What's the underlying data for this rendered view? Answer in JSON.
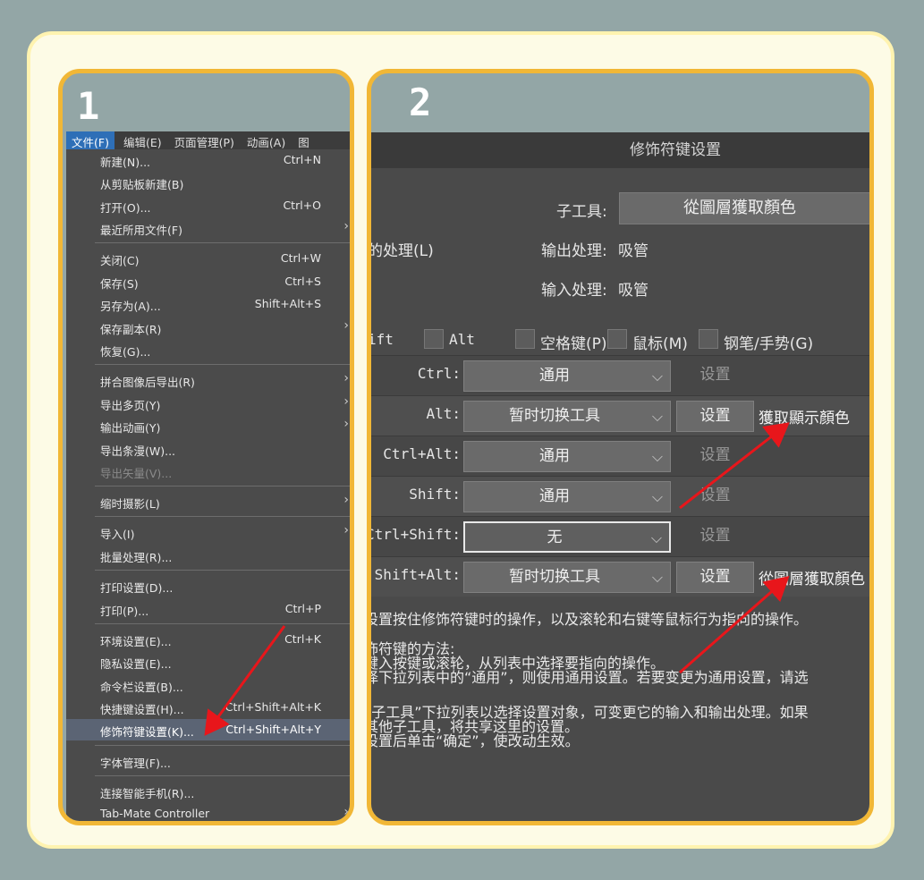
{
  "steps": {
    "one": "1",
    "two": "2"
  },
  "menubar": [
    "文件(F)",
    "编辑(E)",
    "页面管理(P)",
    "动画(A)",
    "图"
  ],
  "menu": {
    "new": {
      "label": "新建(N)...",
      "shortcut": "Ctrl+N"
    },
    "new_clip": {
      "label": "从剪贴板新建(B)"
    },
    "open": {
      "label": "打开(O)...",
      "shortcut": "Ctrl+O"
    },
    "recent": {
      "label": "最近所用文件(F)"
    },
    "close": {
      "label": "关闭(C)",
      "shortcut": "Ctrl+W"
    },
    "save": {
      "label": "保存(S)",
      "shortcut": "Ctrl+S"
    },
    "save_as": {
      "label": "另存为(A)...",
      "shortcut": "Shift+Alt+S"
    },
    "save_copy": {
      "label": "保存副本(R)"
    },
    "revert": {
      "label": "恢复(G)..."
    },
    "flatten_export": {
      "label": "拼合图像后导出(R)"
    },
    "export_multi": {
      "label": "导出多页(Y)"
    },
    "export_anim": {
      "label": "输出动画(Y)"
    },
    "export_strip": {
      "label": "导出条漫(W)..."
    },
    "export_vector": {
      "label": "导出矢量(V)..."
    },
    "timelapse": {
      "label": "缩时摄影(L)"
    },
    "import": {
      "label": "导入(I)"
    },
    "batch": {
      "label": "批量处理(R)..."
    },
    "print_setup": {
      "label": "打印设置(D)..."
    },
    "print": {
      "label": "打印(P)...",
      "shortcut": "Ctrl+P"
    },
    "prefs": {
      "label": "环境设置(E)...",
      "shortcut": "Ctrl+K"
    },
    "privacy": {
      "label": "隐私设置(E)..."
    },
    "command_bar": {
      "label": "命令栏设置(B)..."
    },
    "shortcuts": {
      "label": "快捷键设置(H)...",
      "shortcut": "Ctrl+Shift+Alt+K"
    },
    "modifier": {
      "label": "修饰符键设置(K)...",
      "shortcut": "Ctrl+Shift+Alt+Y"
    },
    "fonts": {
      "label": "字体管理(F)..."
    },
    "smartphone": {
      "label": "连接智能手机(R)..."
    },
    "tabmate": {
      "label": "Tab-Mate Controller"
    }
  },
  "dialog": {
    "title": "修饰符键设置",
    "subtool_label": "子工具:",
    "subtool_value": "從圖層獲取顏色",
    "left_fragment": "的处理(L)",
    "output_label": "输出处理:",
    "output_value": "吸管",
    "input_label": "输入处理:",
    "input_value": "吸管",
    "checks": {
      "shift": "ift",
      "alt": "Alt",
      "space": "空格键(P)",
      "mouse": "鼠标(M)",
      "pen": "钢笔/手势(G)"
    },
    "rows": [
      {
        "key": "Ctrl:",
        "value": "通用",
        "button": "设置",
        "result": ""
      },
      {
        "key": "Alt:",
        "value": "暂时切换工具",
        "button": "设置",
        "result": "獲取顯示顏色"
      },
      {
        "key": "Ctrl+Alt:",
        "value": "通用",
        "button": "设置",
        "result": ""
      },
      {
        "key": "Shift:",
        "value": "通用",
        "button": "设置",
        "result": ""
      },
      {
        "key": "Ctrl+Shift:",
        "value": "无",
        "button": "设置",
        "result": ""
      },
      {
        "key": "Shift+Alt:",
        "value": "暂时切换工具",
        "button": "设置",
        "result": "從圖層獲取顏色"
      }
    ],
    "help": [
      "设置按住修饰符键时的操作，以及滚轮和右键等鼠标行为指向的操作。",
      "饰符键的方法:",
      "键入按键或滚轮，从列表中选择要指向的操作。",
      "择下拉列表中的“通用”，则使用通用设置。若要变更为通用设置，请选",
      "。",
      "“子工具”下拉列表以选择设置对象，可变更它的输入和输出处理。如果",
      "其他子工具，将共享这里的设置。",
      "设置后单击“确定”，使改动生效。"
    ]
  },
  "colors": {
    "panel_border": "#f1b736",
    "arrow": "#e8161b",
    "highlight": "#5b6474"
  },
  "icons": {
    "submenu": "chevron-right-icon",
    "dropdown": "chevron-down-icon",
    "annotation": "red-arrow-icon"
  }
}
